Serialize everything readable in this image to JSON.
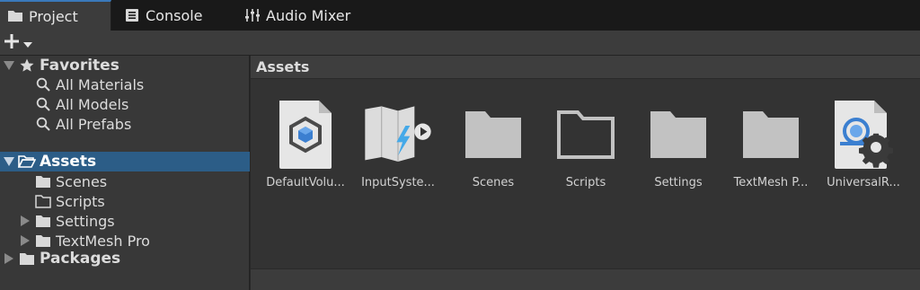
{
  "tabs": [
    {
      "label": "Project",
      "icon": "folder-icon",
      "active": true
    },
    {
      "label": "Console",
      "icon": "console-icon",
      "active": false
    },
    {
      "label": "Audio Mixer",
      "icon": "mixer-icon",
      "active": false
    }
  ],
  "toolbar": {
    "add_label": "+"
  },
  "tree": {
    "favorites_label": "Favorites",
    "all_materials": "All Materials",
    "all_models": "All Models",
    "all_prefabs": "All Prefabs",
    "assets_label": "Assets",
    "scenes": "Scenes",
    "scripts": "Scripts",
    "settings": "Settings",
    "textmesh": "TextMesh Pro",
    "packages_label": "Packages"
  },
  "pane": {
    "title": "Assets",
    "items": [
      {
        "label": "DefaultVolu...",
        "icon": "volume-profile-icon"
      },
      {
        "label": "InputSyste...",
        "icon": "input-actions-icon"
      },
      {
        "label": "Scenes",
        "icon": "folder-icon"
      },
      {
        "label": "Scripts",
        "icon": "empty-folder-icon"
      },
      {
        "label": "Settings",
        "icon": "folder-icon"
      },
      {
        "label": "TextMesh P...",
        "icon": "folder-icon"
      },
      {
        "label": "UniversalR...",
        "icon": "render-pipeline-settings-icon"
      }
    ]
  },
  "colors": {
    "selection": "#2c5d87",
    "accent": "#3a79bb",
    "folder": "#c2c2c2"
  }
}
